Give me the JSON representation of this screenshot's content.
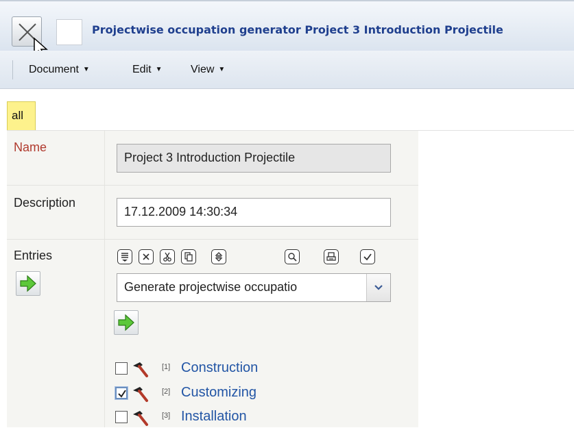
{
  "window": {
    "title": "Projectwise occupation generator Project 3 Introduction Projectile"
  },
  "menu": {
    "items": [
      {
        "label": "Document"
      },
      {
        "label": "Edit"
      },
      {
        "label": "View"
      }
    ]
  },
  "tabs": [
    {
      "label": "all",
      "active": true
    }
  ],
  "form": {
    "name": {
      "label": "Name",
      "value": "Project 3 Introduction Projectile"
    },
    "description": {
      "label": "Description",
      "value": "17.12.2009 14:30:34"
    },
    "entries": {
      "label": "Entries",
      "toolbar_icons": [
        "list-icon",
        "delete-icon",
        "cut-icon",
        "copy-icon",
        "sort-icon",
        "search-icon",
        "print-icon",
        "check-icon"
      ],
      "select": {
        "value": "Generate projectwise occupatio"
      },
      "items": [
        {
          "number": "[1]",
          "label": "Construction",
          "checked": false
        },
        {
          "number": "[2]",
          "label": "Customizing",
          "checked": true
        },
        {
          "number": "[3]",
          "label": "Installation",
          "checked": false
        }
      ]
    }
  },
  "colors": {
    "title": "#1f3f8e",
    "link": "#2255a5",
    "required_label": "#b03a2e",
    "tab_active": "#fdf28c",
    "arrow_green": "#5cc83a"
  }
}
